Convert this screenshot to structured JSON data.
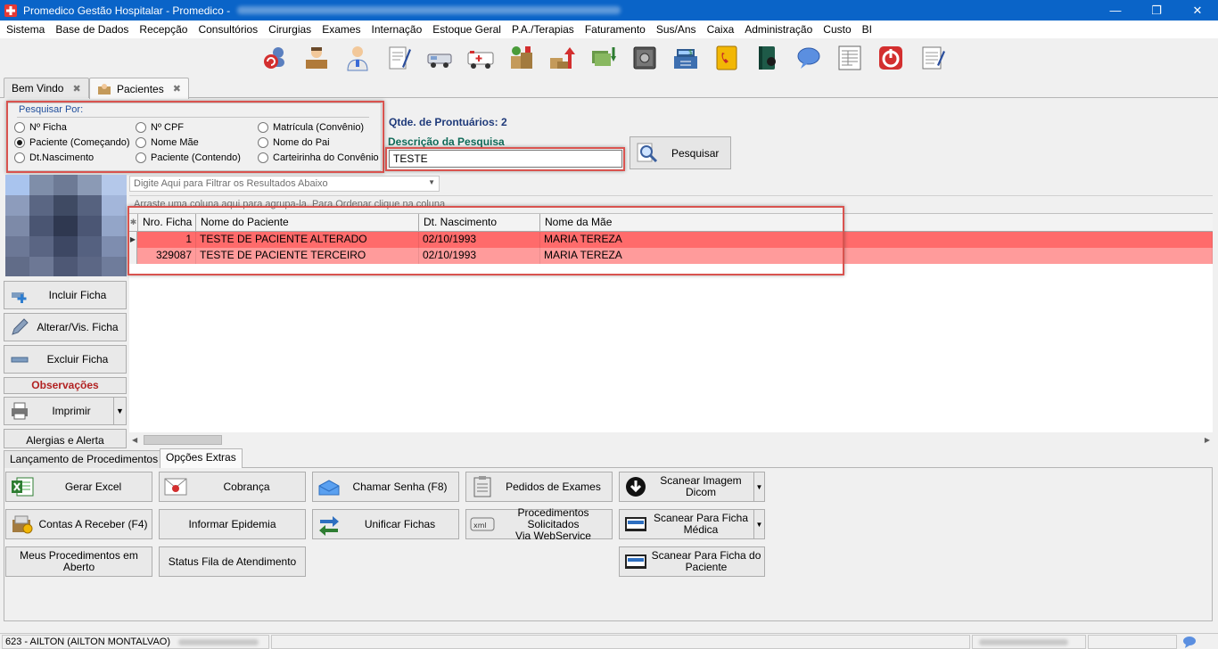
{
  "window": {
    "title": "Promedico Gestão Hospitalar - Promedico -",
    "minimize": "—",
    "maximize": "❐",
    "close": "✕"
  },
  "menu": [
    "Sistema",
    "Base de Dados",
    "Recepção",
    "Consultórios",
    "Cirurgias",
    "Exames",
    "Internação",
    "Estoque Geral",
    "P.A./Terapias",
    "Faturamento",
    "Sus/Ans",
    "Caixa",
    "Administração",
    "Custo",
    "BI"
  ],
  "toolbar_icons": [
    "users-icon",
    "reception-icon",
    "doctor-icon",
    "pen-document-icon",
    "ambulance-car-icon",
    "ambulance-icon",
    "pharmacy-boxes-icon",
    "stock-arrow-icon",
    "download-money-icon",
    "safe-icon",
    "cash-register-icon",
    "phone-book-icon",
    "book-icon",
    "chat-bubble-icon",
    "form-icon",
    "power-icon",
    "notepad-icon"
  ],
  "doc_tabs": [
    {
      "label": "Bem Vindo",
      "active": false
    },
    {
      "label": "Pacientes",
      "active": true
    }
  ],
  "search": {
    "group_label": "Pesquisar Por:",
    "options": [
      {
        "label": "Nº Ficha",
        "checked": false
      },
      {
        "label": "Paciente (Começando)",
        "checked": true
      },
      {
        "label": "Dt.Nascimento",
        "checked": false
      },
      {
        "label": "Nº CPF",
        "checked": false
      },
      {
        "label": "Nome Mãe",
        "checked": false
      },
      {
        "label": "Paciente (Contendo)",
        "checked": false
      },
      {
        "label": "Matrícula (Convênio)",
        "checked": false
      },
      {
        "label": "Nome do Pai",
        "checked": false
      },
      {
        "label": "Carteirinha do Convênio",
        "checked": false
      }
    ],
    "qtde_label": "Qtde. de Prontuários:",
    "qtde_value": "2",
    "desc_label": "Descrição da Pesquisa",
    "input_value": "TESTE",
    "button_label": "Pesquisar"
  },
  "left_panel": {
    "incluir": "Incluir Ficha",
    "alterar": "Alterar/Vis. Ficha",
    "excluir": "Excluir Ficha",
    "observacoes": "Observações",
    "imprimir": "Imprimir",
    "alergias": "Alergias e Alerta"
  },
  "grid": {
    "filter_placeholder": "Digite Aqui para Filtrar os Resultados Abaixo",
    "group_hint": "Arraste uma coluna aqui para agrupa-la. Para Ordenar clique na coluna",
    "columns": [
      "Nro. Ficha",
      "Nome do Paciente",
      "Dt. Nascimento",
      "Nome da Mãe"
    ],
    "rows": [
      {
        "ficha": "1",
        "nome": "TESTE DE PACIENTE ALTERADO",
        "nasc": "02/10/1993",
        "mae": "MARIA TEREZA",
        "color": "#ff6b6b"
      },
      {
        "ficha": "329087",
        "nome": "TESTE DE PACIENTE TERCEIRO",
        "nasc": "02/10/1993",
        "mae": "MARIA TEREZA",
        "color": "#ff9b9b"
      }
    ]
  },
  "bottom_tabs": [
    {
      "label": "Lançamento de Procedimentos",
      "active": false
    },
    {
      "label": "Opções Extras",
      "active": true
    }
  ],
  "extras": {
    "gerar_excel": "Gerar Excel",
    "cobranca": "Cobrança",
    "chamar_senha": "Chamar Senha (F8)",
    "pedidos_exames": "Pedidos de Exames",
    "scanear_dicom": "Scanear Imagem Dicom",
    "contas_receber": "Contas  A Receber  (F4)",
    "informar_epidemia": "Informar Epidemia",
    "unificar_fichas": "Unificar Fichas",
    "proc_solicitados_1": "Procedimentos Solicitados",
    "proc_solicitados_2": "Via WebService",
    "scanear_ficha_medica_1": "Scanear Para Ficha",
    "scanear_ficha_medica_2": "Médica",
    "meus_procedimentos": "Meus Procedimentos em Aberto",
    "status_fila": "Status Fila de Atendimento",
    "scanear_ficha_paciente_1": "Scanear Para Ficha do",
    "scanear_ficha_paciente_2": "Paciente"
  },
  "status": {
    "user": "623 - AILTON (AILTON MONTALVAO)"
  }
}
